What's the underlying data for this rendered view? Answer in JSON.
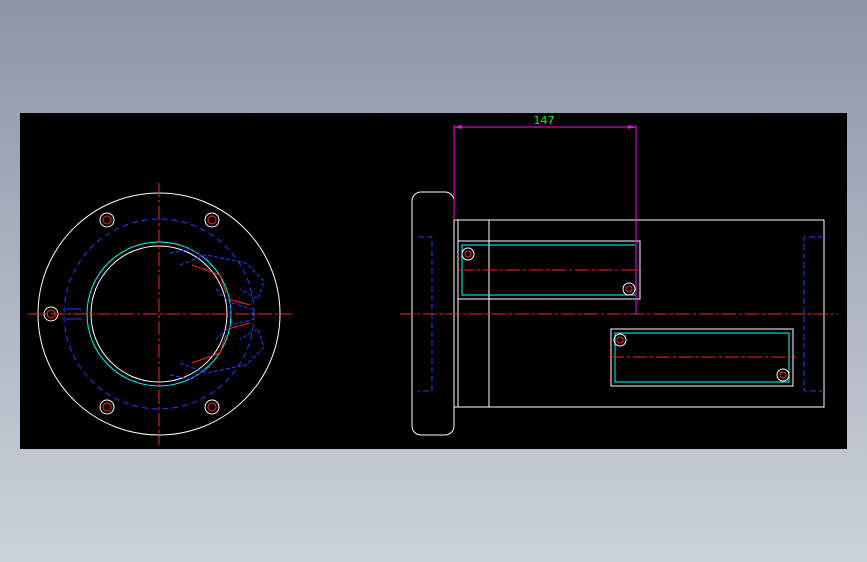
{
  "drawing": {
    "dimension_label": "147"
  },
  "colors": {
    "canvas": "#000000",
    "outline": "#ffffff",
    "centerline": "#ff2020",
    "hidden": "#2a3cff",
    "dimension": "#ff00ff",
    "dimension_text": "#00ff00",
    "accent": "#00ffff"
  }
}
